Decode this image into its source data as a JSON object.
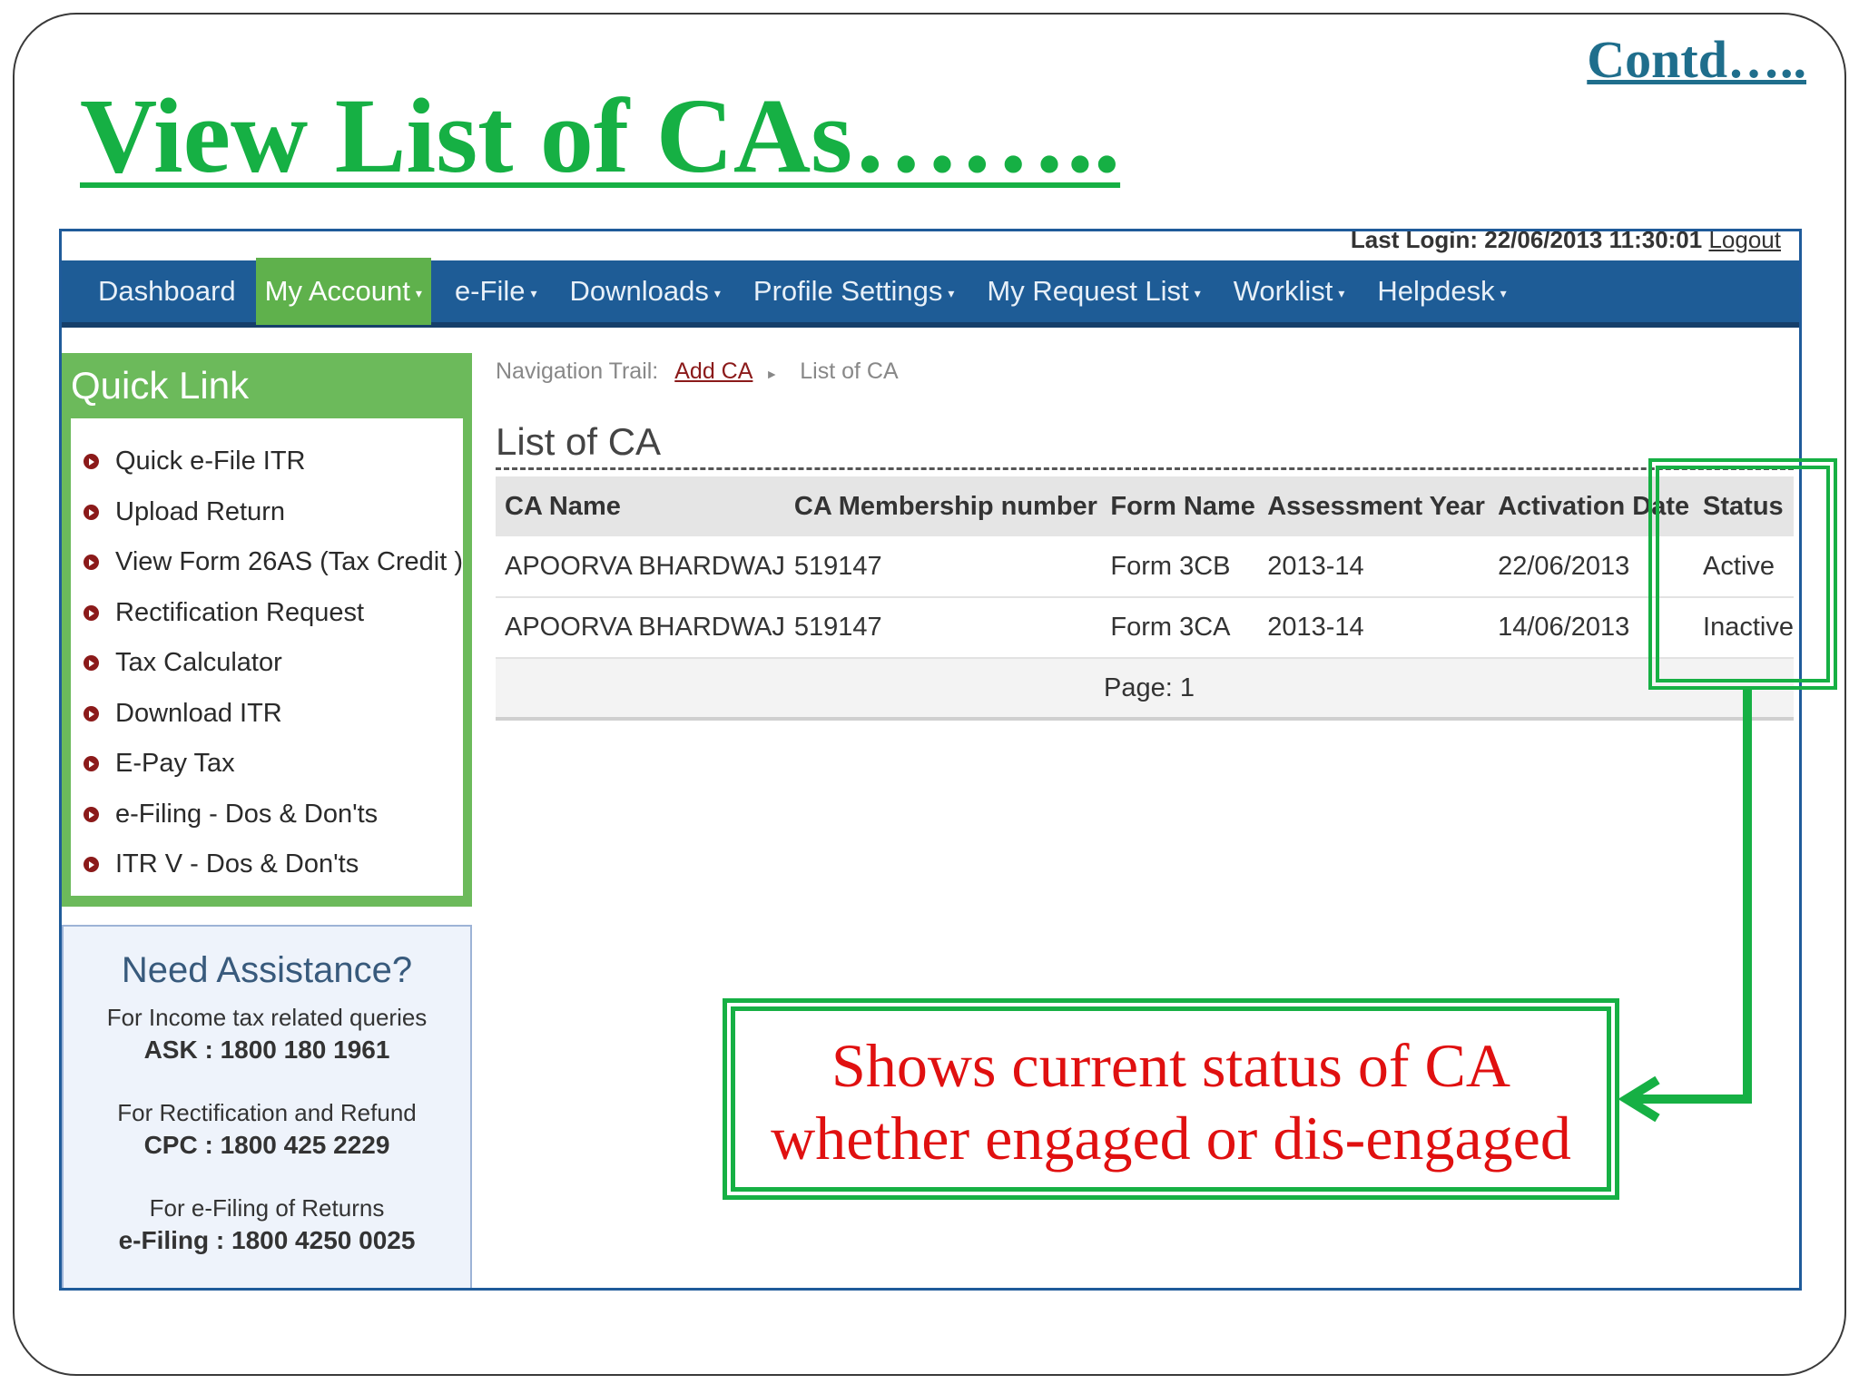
{
  "slide": {
    "title": "View List of CAs……..",
    "contd": "Contd….."
  },
  "header": {
    "last_login": "Last Login: 22/06/2013 11:30:01",
    "logout": "Logout"
  },
  "nav": [
    {
      "label": "Dashboard"
    },
    {
      "label": "My Account"
    },
    {
      "label": "e-File"
    },
    {
      "label": "Downloads"
    },
    {
      "label": "Profile Settings"
    },
    {
      "label": "My Request List"
    },
    {
      "label": "Worklist"
    },
    {
      "label": "Helpdesk"
    }
  ],
  "quick_link": {
    "title": "Quick Link",
    "items": [
      {
        "label": "Quick e-File ITR"
      },
      {
        "label": "Upload Return"
      },
      {
        "label": "View Form 26AS (Tax Credit )"
      },
      {
        "label": "Rectification Request"
      },
      {
        "label": "Tax Calculator"
      },
      {
        "label": "Download ITR"
      },
      {
        "label": "E-Pay Tax"
      },
      {
        "label": "e-Filing - Dos & Don'ts"
      },
      {
        "label": "ITR V - Dos & Don'ts"
      }
    ]
  },
  "assistance": {
    "title": "Need Assistance?",
    "q1": "For Income tax related queries",
    "n1": "ASK : 1800 180 1961",
    "q2": "For Rectification and Refund",
    "n2": "CPC : 1800 425 2229",
    "q3": "For e-Filing of Returns",
    "n3": "e-Filing : 1800 4250 0025"
  },
  "breadcrumb": {
    "label": "Navigation Trail:",
    "link": "Add CA",
    "current": "List of CA"
  },
  "page_heading": "List of CA",
  "table": {
    "headers": [
      "CA Name",
      "CA Membership number",
      "Form Name",
      "Assessment Year",
      "Activation Date",
      "Status"
    ],
    "rows": [
      [
        "APOORVA BHARDWAJ",
        "519147",
        "Form 3CB",
        "2013-14",
        "22/06/2013",
        "Active"
      ],
      [
        "APOORVA BHARDWAJ",
        "519147",
        "Form 3CA",
        "2013-14",
        "14/06/2013",
        "Inactive"
      ]
    ],
    "pager": "Page: 1"
  },
  "annotation": {
    "line1": "Shows current status of CA",
    "line2": "whether engaged or dis-engaged"
  },
  "colors": {
    "title_green": "#16b044",
    "nav_blue": "#1e5c96",
    "quick_green": "#6cba5b",
    "annotation_red": "#e01010"
  }
}
